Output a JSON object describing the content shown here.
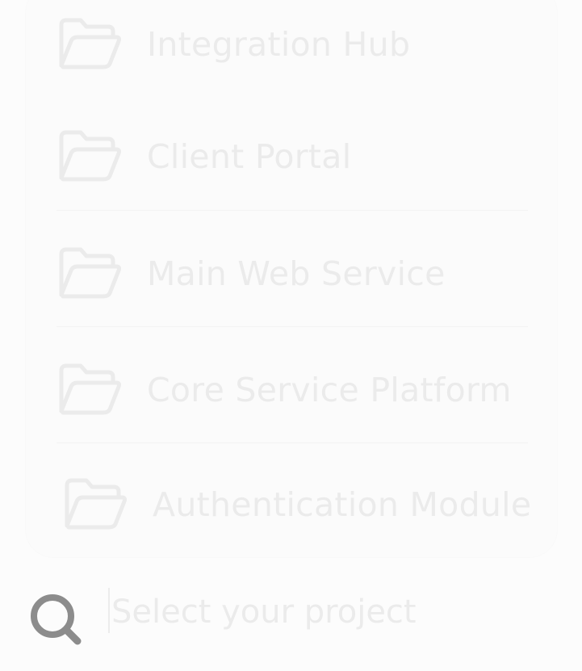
{
  "projects": {
    "items": [
      {
        "label": "Integration Hub",
        "icon": "folder-open-icon"
      },
      {
        "label": "Client Portal",
        "icon": "folder-open-icon"
      },
      {
        "label": "Main Web Service",
        "icon": "folder-open-icon"
      },
      {
        "label": "Core Service Platform",
        "icon": "folder-open-icon"
      },
      {
        "label": "Authentication Module",
        "icon": "folder-open-icon"
      }
    ]
  },
  "search": {
    "placeholder": "Select your project",
    "value": "",
    "icon": "search-icon"
  },
  "colors": {
    "label_text": "#ebebeb",
    "search_icon": "#8c8c8c",
    "background": "#fcfcfc"
  }
}
